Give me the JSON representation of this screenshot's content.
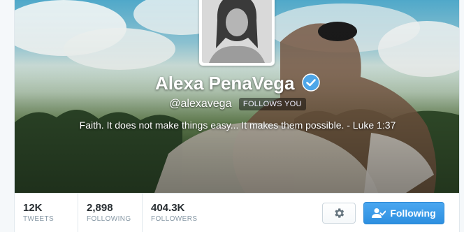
{
  "profile": {
    "name": "Alexa PenaVega",
    "handle": "@alexavega",
    "follows_you": "FOLLOWS YOU",
    "bio": "Faith. It does not make things easy... It makes them possible. - Luke 1:37",
    "verified": true
  },
  "stats": [
    {
      "value": "12K",
      "label": "TWEETS"
    },
    {
      "value": "2,898",
      "label": "FOLLOWING"
    },
    {
      "value": "404.3K",
      "label": "FOLLOWERS"
    }
  ],
  "actions": {
    "following_label": "Following",
    "gear_icon": "gear-icon",
    "follow_icon": "user-check-icon"
  },
  "colors": {
    "accent": "#2d8fe0",
    "verified": "#4ea6e8",
    "stat_label": "#8899a6"
  }
}
